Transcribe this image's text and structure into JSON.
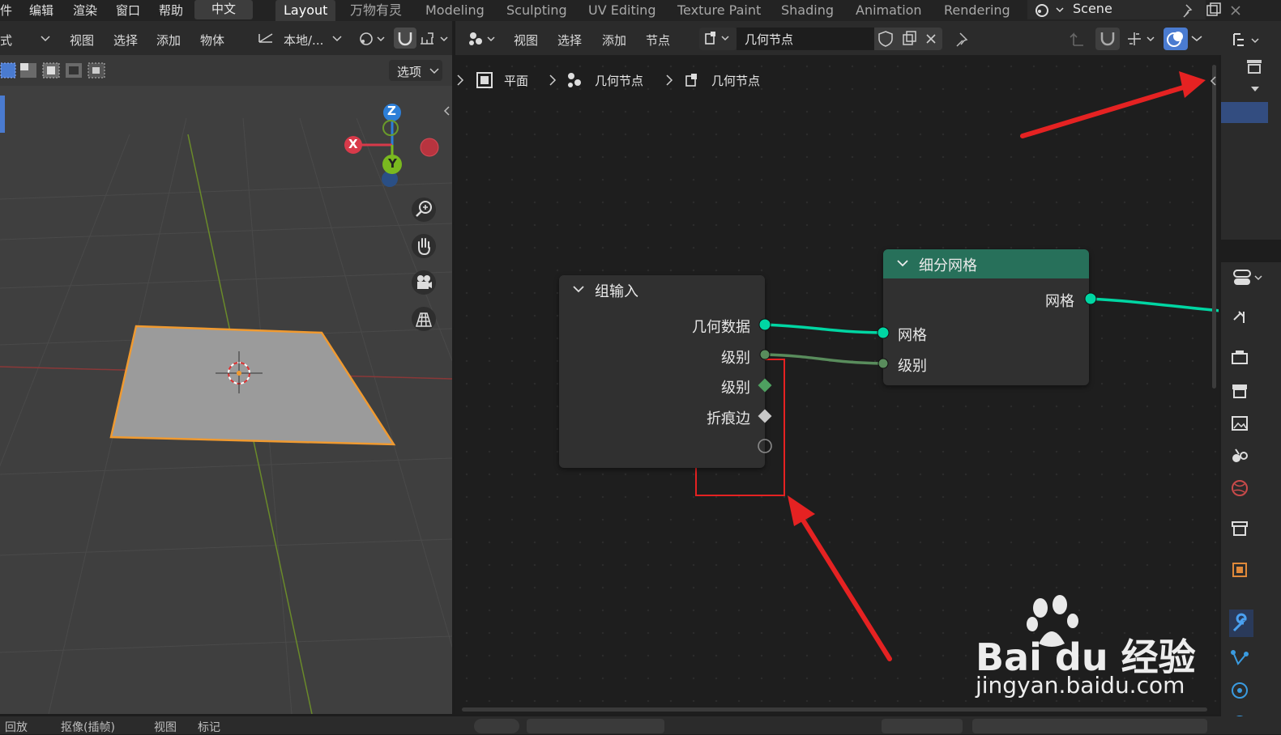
{
  "menu": {
    "items": [
      "件",
      "编辑",
      "渲染",
      "窗口",
      "帮助"
    ],
    "language": "中文"
  },
  "workspace_tabs": [
    "Layout",
    "万物有灵",
    "Modeling",
    "Sculpting",
    "UV Editing",
    "Texture Paint",
    "Shading",
    "Animation",
    "Rendering"
  ],
  "scene": {
    "label": "Scene"
  },
  "viewport_header": {
    "mode_fragment": "式",
    "menus": [
      "视图",
      "选择",
      "添加",
      "物体"
    ],
    "transform_orientation": "本地/...",
    "options_label": "选项"
  },
  "gizmo": {
    "x_label": "X",
    "y_label": "Y",
    "z_label": "Z"
  },
  "node_header": {
    "menus": [
      "视图",
      "选择",
      "添加",
      "节点"
    ],
    "node_tree_name": "几何节点"
  },
  "breadcrumb": [
    "平面",
    "几何节点",
    "几何节点"
  ],
  "group_input_node": {
    "title": "组输入",
    "outputs": [
      "几何数据",
      "级别",
      "级别",
      "折痕边"
    ]
  },
  "subdivide_node": {
    "title": "细分网格",
    "output": "网格",
    "inputs": [
      "网格",
      "级别"
    ]
  },
  "bottom_bar": [
    "回放",
    "抠像(插帧)",
    "视图",
    "标记"
  ],
  "watermark": {
    "brand": "Bai du 经验",
    "url": "jingyan.baidu.com"
  },
  "colors": {
    "accent_blue": "#4a7bd0",
    "geometry_socket": "#00d6a3",
    "int_socket": "#598c5c",
    "node_header_green": "#27705a",
    "highlight_red": "#e52222",
    "selection_orange": "#f09a30"
  }
}
